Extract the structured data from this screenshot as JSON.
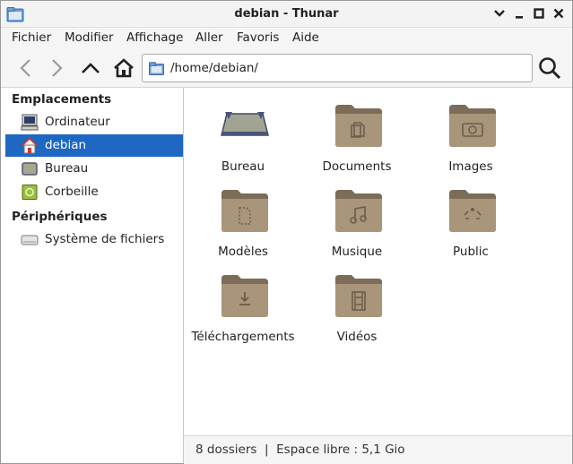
{
  "window": {
    "title": "debian - Thunar"
  },
  "menu": [
    "Fichier",
    "Modifier",
    "Affichage",
    "Aller",
    "Favoris",
    "Aide"
  ],
  "location": {
    "path": "/home/debian/"
  },
  "sidebar": {
    "sections": [
      {
        "title": "Emplacements",
        "items": [
          {
            "label": "Ordinateur",
            "icon": "computer-icon"
          },
          {
            "label": "debian",
            "icon": "home-icon",
            "selected": true
          },
          {
            "label": "Bureau",
            "icon": "desktop-icon"
          },
          {
            "label": "Corbeille",
            "icon": "trash-icon"
          }
        ]
      },
      {
        "title": "Périphériques",
        "items": [
          {
            "label": "Système de fichiers",
            "icon": "drive-icon"
          }
        ]
      }
    ]
  },
  "files": [
    {
      "name": "Bureau",
      "icon": "desktop-folder-icon"
    },
    {
      "name": "Documents",
      "icon": "documents-folder-icon"
    },
    {
      "name": "Images",
      "icon": "pictures-folder-icon"
    },
    {
      "name": "Modèles",
      "icon": "templates-folder-icon"
    },
    {
      "name": "Musique",
      "icon": "music-folder-icon"
    },
    {
      "name": "Public",
      "icon": "public-folder-icon"
    },
    {
      "name": "Téléchargements",
      "icon": "downloads-folder-icon"
    },
    {
      "name": "Vidéos",
      "icon": "videos-folder-icon"
    }
  ],
  "status": {
    "text": "8 dossiers  |  Espace libre : 5,1 Gio"
  },
  "colors": {
    "selection": "#1e67c3",
    "folder": "#a8957a",
    "folder_dark": "#7d6c57"
  }
}
